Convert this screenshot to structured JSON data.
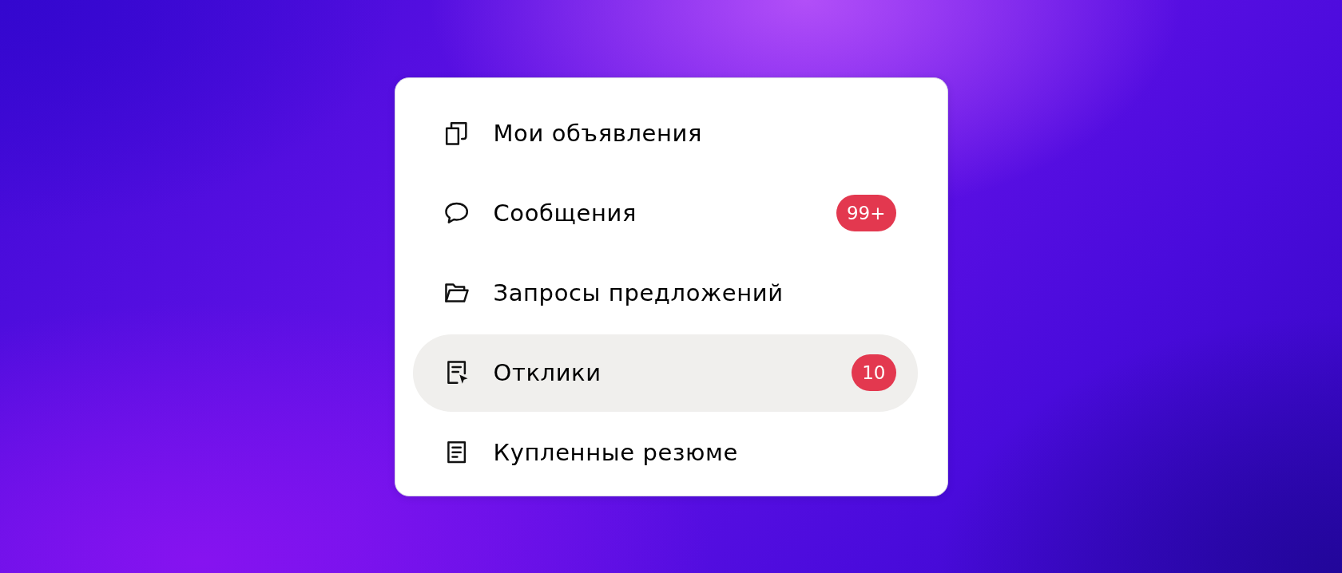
{
  "menu": {
    "items": [
      {
        "label": "Мои объявления",
        "kind": "copies",
        "selected": false
      },
      {
        "label": "Сообщения",
        "kind": "bubble",
        "badge": "99+",
        "selected": false
      },
      {
        "label": "Запросы предложений",
        "kind": "folder",
        "selected": false
      },
      {
        "label": "Отклики",
        "kind": "pointer",
        "badge": "10",
        "selected": true
      },
      {
        "label": "Купленные резюме",
        "kind": "sheet",
        "selected": false
      }
    ]
  }
}
